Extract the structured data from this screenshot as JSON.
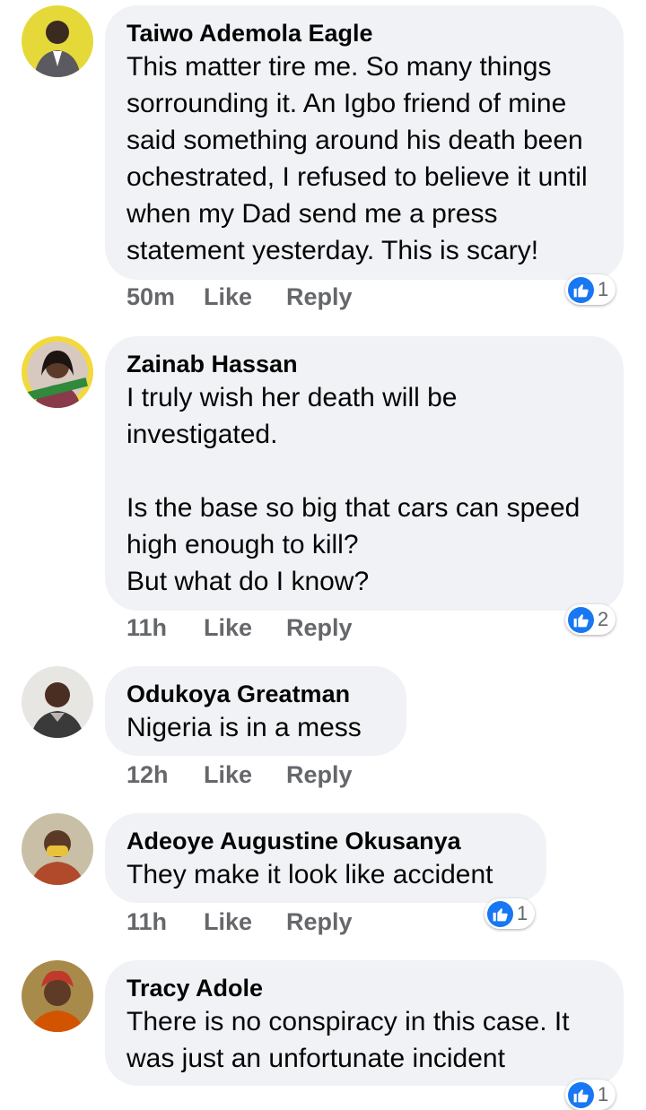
{
  "comments": [
    {
      "author": "Taiwo Ademola Eagle",
      "text": "This matter tire me. So many things sorrounding it. An Igbo friend of mine said something around his death been ochestrated, I refused to believe it until when my Dad send me a press statement yesterday. This is scary!",
      "time": "50m",
      "like": "Like",
      "reply": "Reply",
      "reactions": "1"
    },
    {
      "author": "Zainab Hassan",
      "text": "I truly wish her death will be investigated.\n\nIs the base so big that cars can speed  high enough to kill?\nBut what do I know?",
      "time": "11h",
      "like": "Like",
      "reply": "Reply",
      "reactions": "2"
    },
    {
      "author": "Odukoya Greatman",
      "text": "Nigeria is in a mess",
      "time": "12h",
      "like": "Like",
      "reply": "Reply"
    },
    {
      "author": "Adeoye Augustine Okusanya",
      "text": "They make it look like accident",
      "time": "11h",
      "like": "Like",
      "reply": "Reply",
      "reactions": "1"
    },
    {
      "author": "Tracy Adole",
      "text": "There is no conspiracy in this case. It was just an unfortunate incident",
      "reactions": "1"
    }
  ],
  "colors": {
    "bubble": "#f0f2f5",
    "meta": "#65676b",
    "like_blue": "#1877f2"
  }
}
